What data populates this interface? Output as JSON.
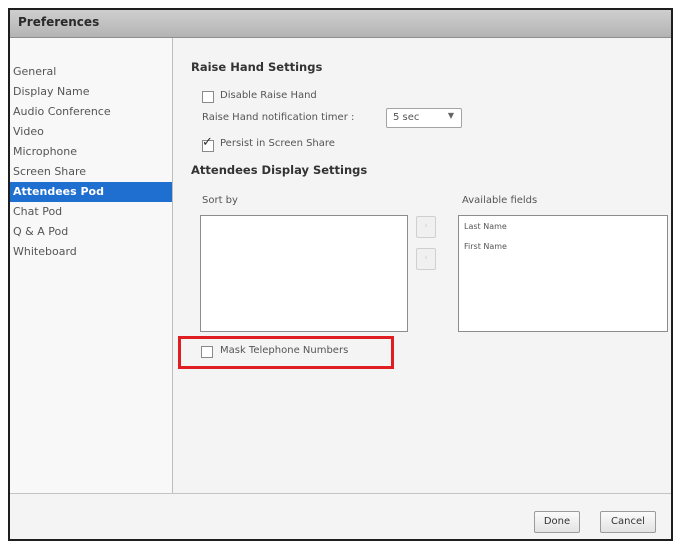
{
  "window": {
    "title": "Preferences"
  },
  "sidebar": {
    "items": [
      {
        "label": "General",
        "selected": false
      },
      {
        "label": "Display Name",
        "selected": false
      },
      {
        "label": "Audio Conference",
        "selected": false
      },
      {
        "label": "Video",
        "selected": false
      },
      {
        "label": "Microphone",
        "selected": false
      },
      {
        "label": "Screen Share",
        "selected": false
      },
      {
        "label": "Attendees Pod",
        "selected": true
      },
      {
        "label": "Chat Pod",
        "selected": false
      },
      {
        "label": "Q & A Pod",
        "selected": false
      },
      {
        "label": "Whiteboard",
        "selected": false
      }
    ]
  },
  "raise_hand": {
    "heading": "Raise Hand Settings",
    "disable_label": "Disable Raise Hand",
    "disable_checked": false,
    "timer_label": "Raise Hand notification timer :",
    "timer_value": "5 sec",
    "persist_label": "Persist in Screen Share",
    "persist_checked": true
  },
  "attendees_display": {
    "heading": "Attendees Display Settings",
    "sort_by_label": "Sort by",
    "sort_by_items": [],
    "available_label": "Available fields",
    "available_items": [
      "Last Name",
      "First Name"
    ],
    "move_right_glyph": "›",
    "move_left_glyph": "‹",
    "mask_label": "Mask Telephone Numbers",
    "mask_checked": false
  },
  "footer": {
    "done_label": "Done",
    "cancel_label": "Cancel"
  },
  "colors": {
    "selection": "#1f6fd0",
    "highlight": "#e01e22"
  },
  "icons": {
    "check": "checkmark-icon",
    "dropdown": "chevron-down-icon"
  }
}
